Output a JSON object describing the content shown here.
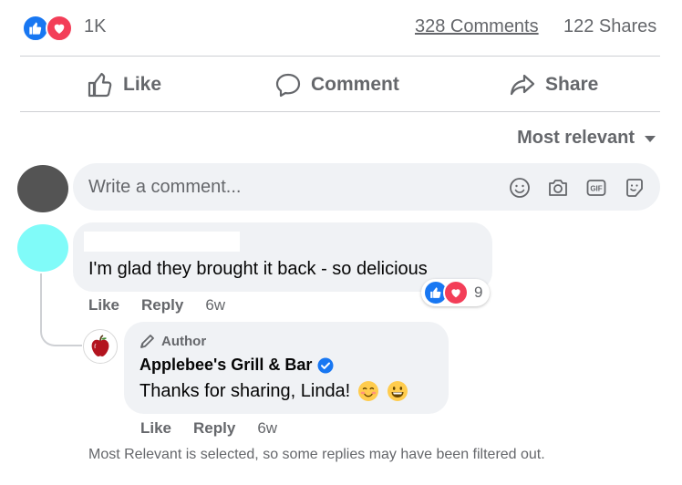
{
  "reactions": {
    "count": "1K",
    "comments_label": "328 Comments",
    "shares_label": "122 Shares",
    "like_color": "#1877f2",
    "love_color": "#f33e58"
  },
  "actions": {
    "like": "Like",
    "comment": "Comment",
    "share": "Share"
  },
  "sort": {
    "label": "Most relevant"
  },
  "composer": {
    "placeholder": "Write a comment...",
    "tools": [
      "emoji-icon",
      "camera-icon",
      "gif-icon",
      "sticker-icon"
    ]
  },
  "comments": [
    {
      "text": "I'm glad they brought it back - so delicious",
      "reaction_count": "9",
      "like_label": "Like",
      "reply_label": "Reply",
      "time": "6w",
      "replies": [
        {
          "badge": "Author",
          "name": "Applebee's Grill & Bar",
          "verified": true,
          "text": "Thanks for sharing, Linda!",
          "like_label": "Like",
          "reply_label": "Reply",
          "time": "6w"
        }
      ]
    }
  ],
  "footer": {
    "filter_note": "Most Relevant is selected, so some replies may have been filtered out."
  }
}
